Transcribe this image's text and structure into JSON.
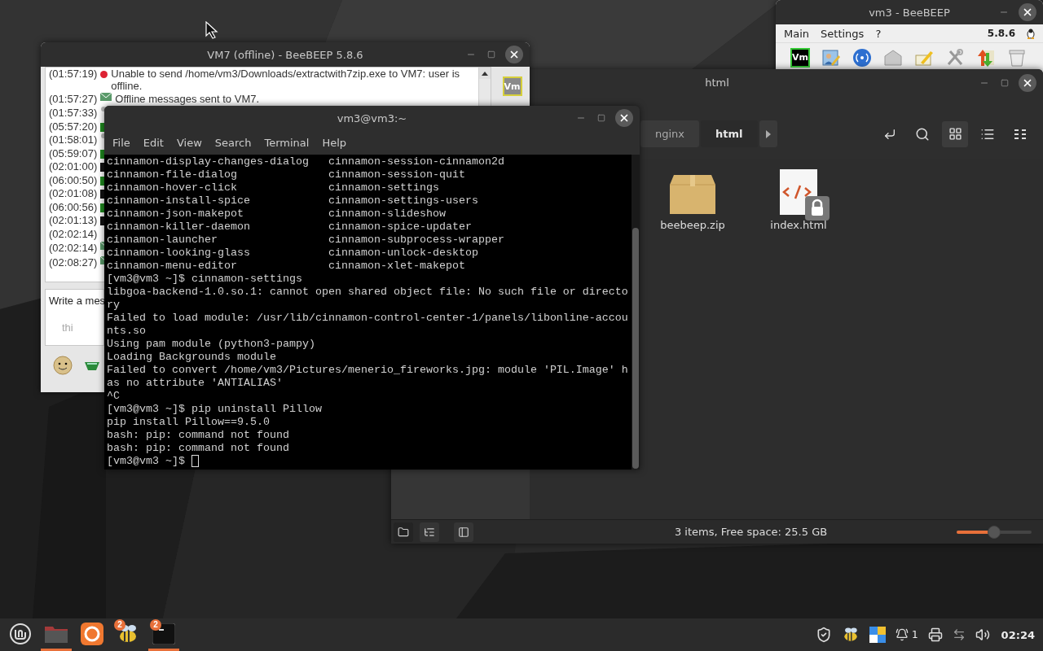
{
  "beebeep_main": {
    "title": "vm3 - BeeBEEP",
    "menu": [
      "Main",
      "Settings",
      "?"
    ],
    "version": "5.8.6",
    "user_badge": "Vm"
  },
  "file_manager": {
    "title": "html",
    "breadcrumbs": [
      {
        "label": "nginx",
        "selected": false
      },
      {
        "label": "html",
        "selected": true
      }
    ],
    "view_modes": [
      {
        "kind": "icons",
        "selected": true
      },
      {
        "kind": "list",
        "selected": false
      },
      {
        "kind": "compact",
        "selected": false
      }
    ],
    "files": [
      {
        "name": "beebeep.zip",
        "kind": "archive",
        "locked": false
      },
      {
        "name": "index.html",
        "kind": "html",
        "locked": true
      }
    ],
    "sidebar_modes": [
      {
        "kind": "places",
        "selected": true
      },
      {
        "kind": "tree",
        "selected": false
      },
      {
        "kind": "toggle",
        "selected": false
      }
    ],
    "status": "3 items, Free space: 25.5 GB",
    "zoom": {
      "level": 0.5
    }
  },
  "chat": {
    "title": "VM7 (offline) - BeeBEEP 5.8.6",
    "messages": [
      {
        "time": "(01:57:19)",
        "kind": "error",
        "text": "Unable to send /home/vm3/Downloads/extractwith7zip.exe to VM7: user is offline."
      },
      {
        "time": "(01:57:27)",
        "kind": "mail",
        "text": "Offline messages sent to VM7."
      },
      {
        "time": "(01:57:33)",
        "kind": "system"
      },
      {
        "time": "(05:57:20)",
        "kind": "peer"
      },
      {
        "time": "(01:58:01)",
        "kind": "system"
      },
      {
        "time": "(05:59:07)",
        "kind": "peer"
      },
      {
        "time": "(02:01:00)",
        "kind": "self"
      },
      {
        "time": "(06:00:50)",
        "kind": "peer"
      },
      {
        "time": "(02:01:08)",
        "kind": "self"
      },
      {
        "time": "(06:00:56)",
        "kind": "peer"
      },
      {
        "time": "(02:01:13)",
        "kind": "self"
      },
      {
        "time": "(02:02:14)",
        "kind": "plain"
      },
      {
        "time": "(02:02:14)",
        "kind": "mail"
      },
      {
        "time": "(02:08:27)",
        "kind": "mail"
      }
    ],
    "input": {
      "hint": "Write a mes",
      "typed": "thi"
    },
    "user_badge": "Vm"
  },
  "terminal": {
    "title": "vm3@vm3:~",
    "menu": [
      "File",
      "Edit",
      "View",
      "Search",
      "Terminal",
      "Help"
    ],
    "lines": [
      {
        "kind": "pair",
        "left": "cinnamon-display-changes-dialog",
        "right": "cinnamon-session-cinnamon2d"
      },
      {
        "kind": "pair",
        "left": "cinnamon-file-dialog",
        "right": "cinnamon-session-quit"
      },
      {
        "kind": "pair",
        "left": "cinnamon-hover-click",
        "right": "cinnamon-settings"
      },
      {
        "kind": "pair",
        "left": "cinnamon-install-spice",
        "right": "cinnamon-settings-users"
      },
      {
        "kind": "pair",
        "left": "cinnamon-json-makepot",
        "right": "cinnamon-slideshow"
      },
      {
        "kind": "pair",
        "left": "cinnamon-killer-daemon",
        "right": "cinnamon-spice-updater"
      },
      {
        "kind": "pair",
        "left": "cinnamon-launcher",
        "right": "cinnamon-subprocess-wrapper"
      },
      {
        "kind": "pair",
        "left": "cinnamon-looking-glass",
        "right": "cinnamon-unlock-desktop"
      },
      {
        "kind": "pair",
        "left": "cinnamon-menu-editor",
        "right": "cinnamon-xlet-makepot"
      },
      {
        "kind": "text",
        "text": "[vm3@vm3 ~]$ cinnamon-settings"
      },
      {
        "kind": "text",
        "text": "libgoa-backend-1.0.so.1: cannot open shared object file: No such file or directo"
      },
      {
        "kind": "text",
        "text": "ry"
      },
      {
        "kind": "text",
        "text": "Failed to load module: /usr/lib/cinnamon-control-center-1/panels/libonline-accou"
      },
      {
        "kind": "text",
        "text": "nts.so"
      },
      {
        "kind": "text",
        "text": "Using pam module (python3-pampy)"
      },
      {
        "kind": "text",
        "text": "Loading Backgrounds module"
      },
      {
        "kind": "text",
        "text": "Failed to convert /home/vm3/Pictures/menerio_fireworks.jpg: module 'PIL.Image' h"
      },
      {
        "kind": "text",
        "text": "as no attribute 'ANTIALIAS'"
      },
      {
        "kind": "text",
        "text": "^C"
      },
      {
        "kind": "text",
        "text": "[vm3@vm3 ~]$ pip uninstall Pillow"
      },
      {
        "kind": "text",
        "text": "pip install Pillow==9.5.0"
      },
      {
        "kind": "text",
        "text": "bash: pip: command not found"
      },
      {
        "kind": "text",
        "text": "bash: pip: command not found"
      },
      {
        "kind": "cursor",
        "text": "[vm3@vm3 ~]$"
      }
    ]
  },
  "taskbar": {
    "apps": [
      {
        "kind": "files",
        "running": true
      },
      {
        "kind": "firefox",
        "running": false
      },
      {
        "kind": "beebeep",
        "running": false,
        "badge": "2"
      },
      {
        "kind": "terminal",
        "running": true,
        "badge": "2"
      }
    ],
    "notifications": "1",
    "clock": "02:24"
  }
}
